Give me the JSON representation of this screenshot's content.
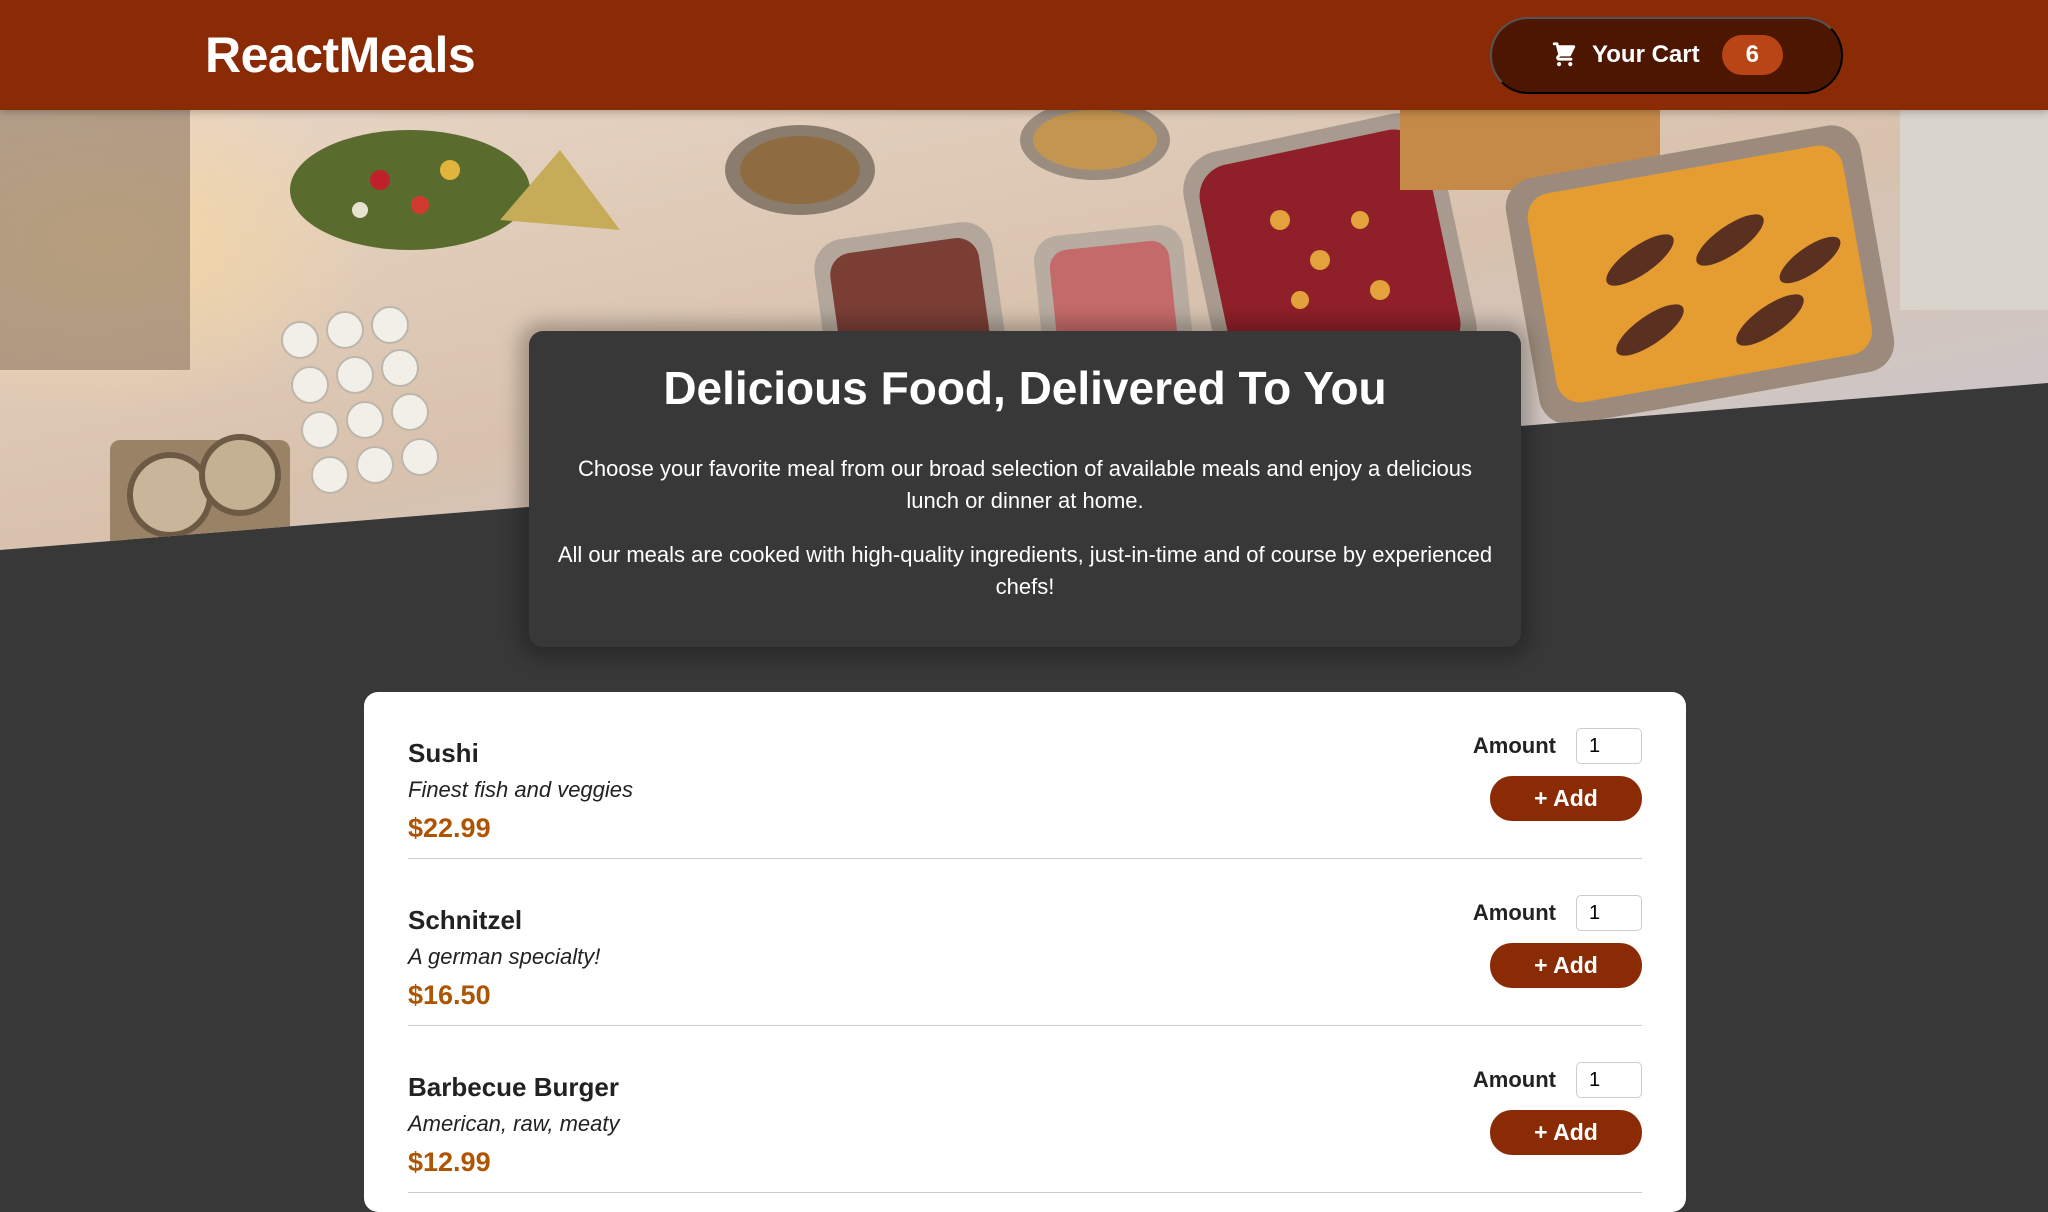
{
  "header": {
    "brand": "ReactMeals",
    "cart": {
      "label": "Your Cart",
      "count": "6",
      "icon": "cart-icon"
    }
  },
  "hero": {
    "image": "catering-buffet-table",
    "title": "Delicious Food, Delivered To You",
    "paragraph1": "Choose your favorite meal from our broad selection of available meals and enjoy a delicious lunch or dinner at home.",
    "paragraph2": "All our meals are cooked with high-quality ingredients, just-in-time and of course by experienced chefs!"
  },
  "meals": [
    {
      "name": "Sushi",
      "description": "Finest fish and veggies",
      "price": "$22.99",
      "amount_label": "Amount",
      "amount_value": "1",
      "add_label": "+ Add"
    },
    {
      "name": "Schnitzel",
      "description": "A german specialty!",
      "price": "$16.50",
      "amount_label": "Amount",
      "amount_value": "1",
      "add_label": "+ Add"
    },
    {
      "name": "Barbecue Burger",
      "description": "American, raw, meaty",
      "price": "$12.99",
      "amount_label": "Amount",
      "amount_value": "1",
      "add_label": "+ Add"
    }
  ],
  "colors": {
    "header": "#8a2b06",
    "cart_button": "#4d1601",
    "badge": "#b94517",
    "page_bg": "#383838",
    "price": "#ad5502"
  }
}
